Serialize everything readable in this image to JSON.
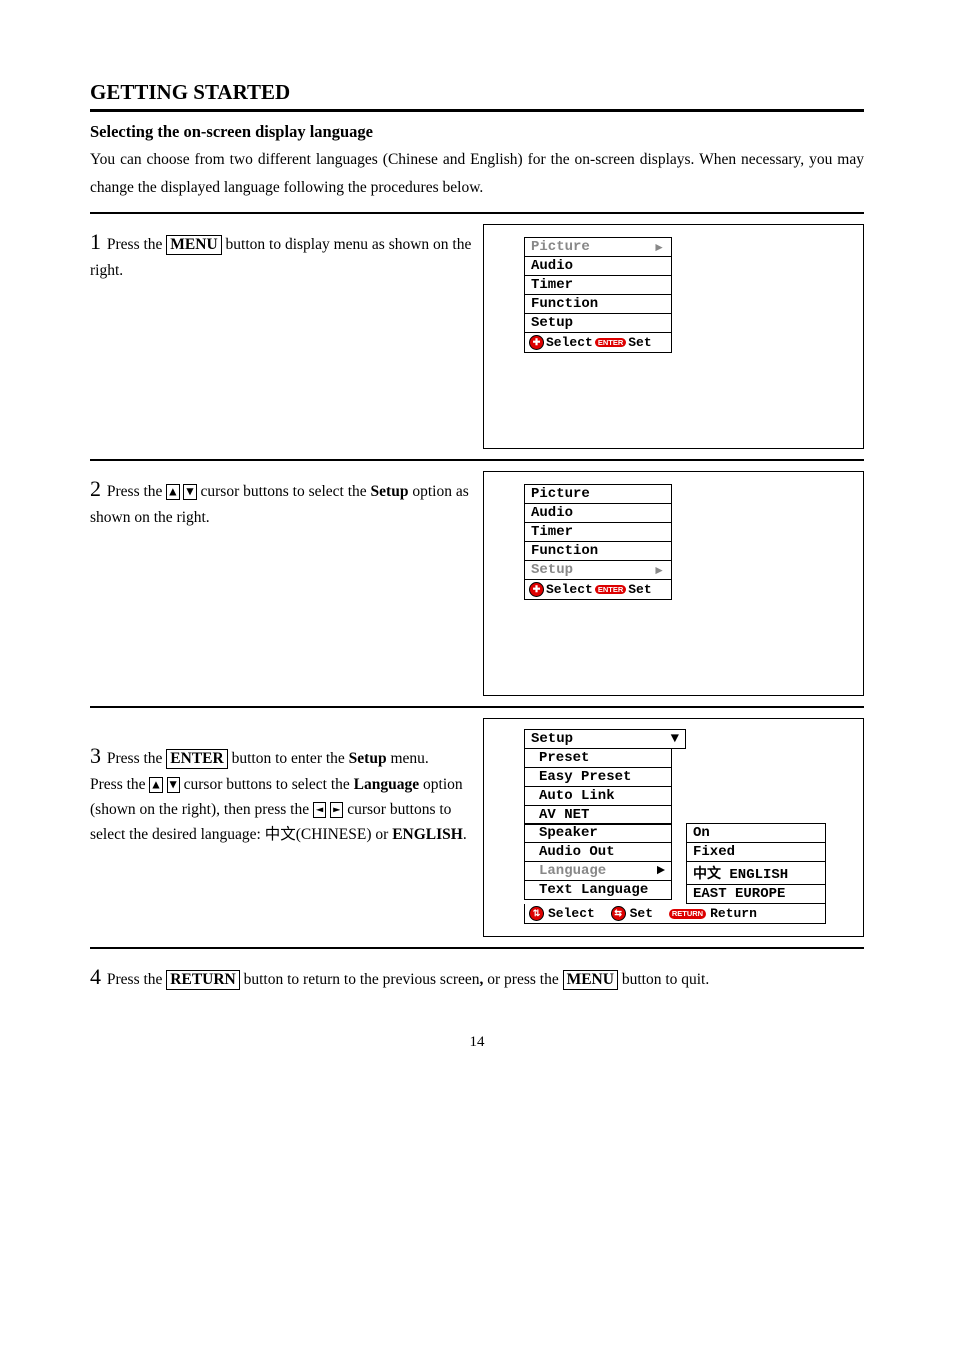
{
  "header": {
    "title": "GETTING STARTED"
  },
  "section": {
    "subhead": "Selecting the on-screen display language",
    "intro": "You can choose from two different languages (Chinese and English) for the on-screen displays. When necessary, you may change the displayed language following the procedures below."
  },
  "keys": {
    "menu": "MENU",
    "enter": "ENTER",
    "return": "RETURN",
    "up": "▲",
    "down": "▼",
    "left": "◄",
    "right": "►"
  },
  "steps": {
    "s1": {
      "num": "1",
      "pre": "Press the ",
      "post": " button to display menu as shown on the right."
    },
    "s2": {
      "num": "2",
      "pre": "Press the ",
      "mid": " cursor buttons to select the ",
      "bold": "Setup",
      "post": " option as shown on the right."
    },
    "s3": {
      "num": "3",
      "l1a": "Press the ",
      "l1b": " button to enter the ",
      "l1bold": "Setup",
      "l1c": " menu.",
      "l2a": "Press the ",
      "l2b": " cursor buttons to select the ",
      "l2bold": "Language",
      "l2c": " option (shown on the right), then press the ",
      "l2d": " cursor buttons to select the desired language:  ",
      "l2cn": "中文",
      "l2cn2": "(CHINESE) or ",
      "l2en": "ENGLISH",
      "l2e": "."
    },
    "s4": {
      "num": "4",
      "a": "Press the ",
      "b": " button to return to the previous screen",
      "comma": ", ",
      "c": "or press the ",
      "d": " button to quit."
    }
  },
  "menu1": {
    "items": [
      "Picture",
      "Audio",
      "Timer",
      "Function",
      "Setup"
    ],
    "selected_index": 0,
    "legend_select": "Select",
    "legend_enter": "ENTER",
    "legend_set": "Set"
  },
  "menu2": {
    "items": [
      "Picture",
      "Audio",
      "Timer",
      "Function",
      "Setup"
    ],
    "selected_index": 4,
    "legend_select": "Select",
    "legend_enter": "ENTER",
    "legend_set": "Set"
  },
  "setup": {
    "head": "Setup",
    "left": [
      "Preset",
      "Easy Preset",
      "Auto Link",
      "AV NET",
      "Speaker",
      "Audio Out",
      "Language",
      "Text Language"
    ],
    "right": {
      "speaker": "On",
      "audio_out": "Fixed",
      "language": "中文  ENGLISH",
      "text_language": "EAST EUROPE"
    },
    "selected_left_index": 6,
    "legend_select": "Select",
    "legend_set": "Set",
    "legend_return_pill": "RETURN",
    "legend_return": "Return"
  },
  "page_number": "14"
}
